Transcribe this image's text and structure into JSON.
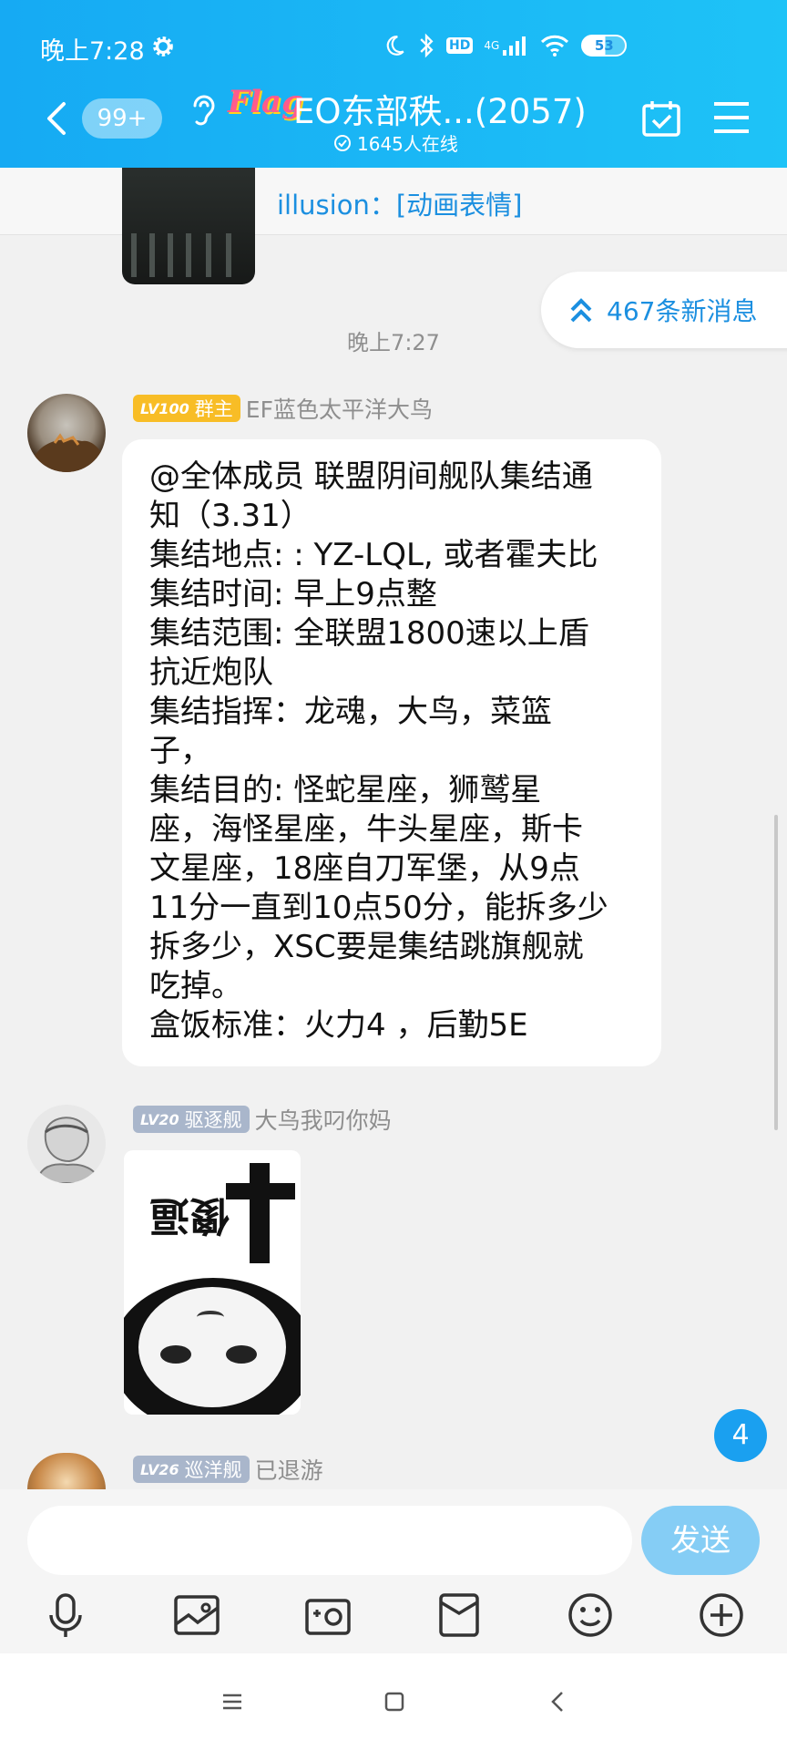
{
  "status_bar": {
    "time": "晚上7:28",
    "battery": "53",
    "network": "4G",
    "hd": "HD"
  },
  "header": {
    "unread_badge": "99+",
    "logo_text": "Flag",
    "title": "EO东部秩...(2057)",
    "online": "1645人在线"
  },
  "pinned": {
    "text": "illusion：[动画表情]"
  },
  "new_messages": "467条新消息",
  "time_separator": "晚上7:27",
  "messages": [
    {
      "level": "LV100",
      "role": "群主",
      "sender": "EF蓝色太平洋大鸟",
      "lines": [
        "@全体成员 联盟阴间舰队集结通",
        "知（3.31）",
        "集结地点: : YZ-LQL, 或者霍夫比",
        "集结时间: 早上9点整",
        "集结范围: 全联盟1800速以上盾",
        "抗近炮队",
        "集结指挥：龙魂，大鸟，菜篮",
        "子，",
        "集结目的: 怪蛇星座，狮鹫星",
        "座，海怪星座，牛头星座，斯卡",
        "文星座，18座自刀军堡，从9点",
        "11分一直到10点50分，能拆多少",
        "拆多少，XSC要是集结跳旗舰就",
        "吃掉。",
        "盒饭标准：火力4 ，后勤5E"
      ]
    },
    {
      "level": "LV20",
      "role": "驱逐舰",
      "sender": "大鸟我叼你妈",
      "sticker_text": "傻逼"
    },
    {
      "level": "LV26",
      "role": "巡洋舰",
      "sender": "已退游"
    }
  ],
  "unread_count": "4",
  "input": {
    "placeholder": "",
    "send_label": "发送"
  },
  "colors": {
    "header": "#16aaf3",
    "accent": "#1b8fe0",
    "send": "#85cdf5"
  }
}
